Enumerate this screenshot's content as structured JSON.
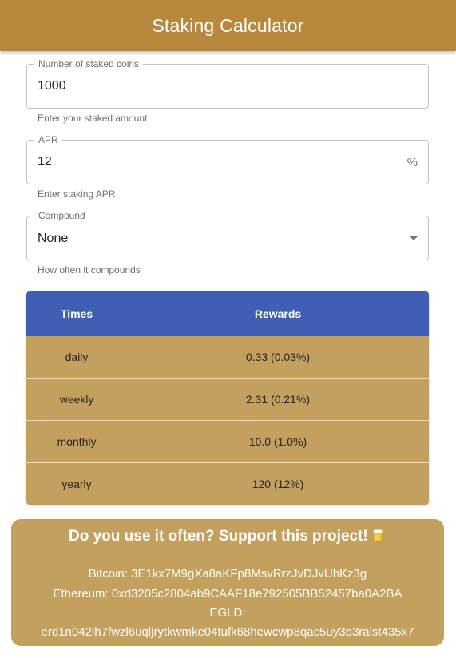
{
  "header": {
    "title": "Staking Calculator"
  },
  "form": {
    "coins": {
      "label": "Number of staked coins",
      "value": "1000",
      "helper": "Enter your staked amount"
    },
    "apr": {
      "label": "APR",
      "value": "12",
      "suffix": "%",
      "helper": "Enter staking APR"
    },
    "compound": {
      "label": "Compound",
      "value": "None",
      "helper": "How often it compounds"
    }
  },
  "table": {
    "headers": [
      "Times",
      "Rewards"
    ],
    "rows": [
      {
        "time": "daily",
        "reward": "0.33 (0.03%)"
      },
      {
        "time": "weekly",
        "reward": "2.31 (0.21%)"
      },
      {
        "time": "monthly",
        "reward": "10.0 (1.0%)"
      },
      {
        "time": "yearly",
        "reward": "120 (12%)"
      }
    ]
  },
  "support": {
    "title": "Do you use it often? Support this project!",
    "icon": "beer-mug-icon",
    "bitcoin": "Bitcoin: 3E1kx7M9gXa8aKFp8MsvRrzJvDJvUhKz3g",
    "ethereum": "Ethereum: 0xd3205c2804ab9CAAF18e792505BB52457ba0A2BA",
    "egld_label": "EGLD:",
    "egld": "erd1n042lh7fwzl6uqljrytkwmke04tufk68hewcwp8qac5uy3p3ralst435x7"
  },
  "colors": {
    "appbar": "#b8893d",
    "table_header": "#3f5fb5",
    "table_row": "#c4a05e",
    "support_bg": "#c4a05e"
  }
}
